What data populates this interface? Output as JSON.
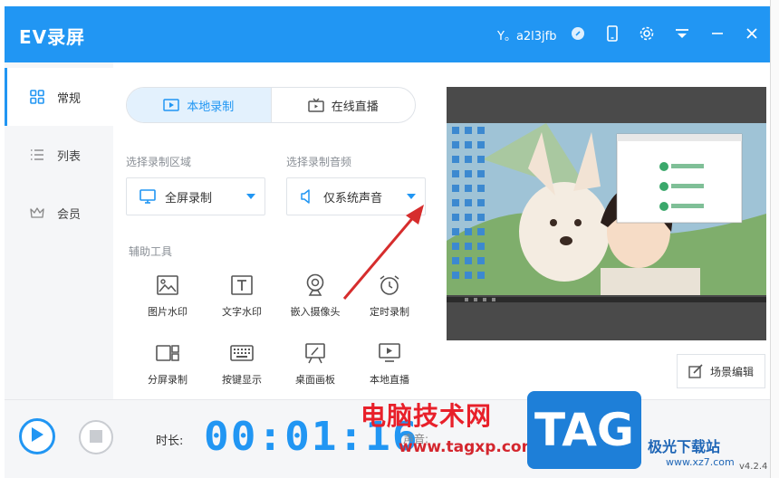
{
  "app": {
    "title": "EV录屏",
    "user": "Y。a2l3jfb"
  },
  "colors": {
    "accent": "#2196f3",
    "arrow": "#d62d2d"
  },
  "sidebar": {
    "items": [
      {
        "label": "常规",
        "icon": "grid-icon",
        "active": true
      },
      {
        "label": "列表",
        "icon": "list-icon",
        "active": false
      },
      {
        "label": "会员",
        "icon": "crown-icon",
        "active": false
      }
    ]
  },
  "tabs": [
    {
      "label": "本地录制",
      "icon": "video-icon",
      "active": true
    },
    {
      "label": "在线直播",
      "icon": "tv-icon",
      "active": false
    }
  ],
  "area": {
    "label": "选择录制区域",
    "value": "全屏录制"
  },
  "audio": {
    "label": "选择录制音频",
    "value": "仅系统声音"
  },
  "tools": {
    "label": "辅助工具",
    "items": [
      {
        "label": "图片水印",
        "icon": "image-icon"
      },
      {
        "label": "文字水印",
        "icon": "text-icon"
      },
      {
        "label": "嵌入摄像头",
        "icon": "webcam-icon"
      },
      {
        "label": "定时录制",
        "icon": "alarm-icon"
      },
      {
        "label": "分屏录制",
        "icon": "split-screen-icon"
      },
      {
        "label": "按键显示",
        "icon": "keyboard-icon"
      },
      {
        "label": "桌面画板",
        "icon": "easel-icon"
      },
      {
        "label": "本地直播",
        "icon": "monitor-play-icon"
      }
    ]
  },
  "scene_button": "场景编辑",
  "bottom": {
    "duration_label": "时长:",
    "timer": "00:01:16",
    "volume_label": "声音:",
    "version": "v4.2.4"
  },
  "watermark": {
    "text": "电脑技术网",
    "url": "www.tagxp.com",
    "tag": "TAG",
    "site": "极光下载站",
    "site_url": "www.xz7.com"
  }
}
